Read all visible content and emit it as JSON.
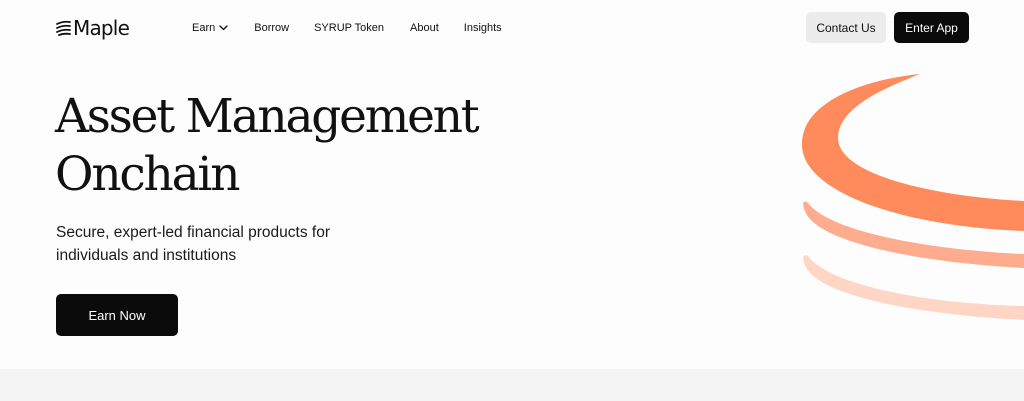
{
  "header": {
    "logo": {
      "text": "Maple",
      "icon": "maple-stripes-logo"
    },
    "nav": [
      {
        "label": "Earn",
        "has_dropdown": true
      },
      {
        "label": "Borrow"
      },
      {
        "label": "SYRUP Token"
      },
      {
        "label": "About"
      },
      {
        "label": "Insights"
      }
    ],
    "contact_label": "Contact Us",
    "enter_label": "Enter App"
  },
  "hero": {
    "title_line1": "Asset Management",
    "title_line2": "Onchain",
    "subtitle": "Secure, expert-led financial products for individuals and institutions",
    "cta_label": "Earn Now"
  },
  "colors": {
    "accent": "#ff8a5c",
    "accent_mid": "#ffab8d",
    "accent_light": "#ffd6c6",
    "button_dark": "#0b0b0b",
    "button_light": "#ececec"
  },
  "icons": [
    "chevron-down-icon",
    "orange-rings-graphic"
  ]
}
